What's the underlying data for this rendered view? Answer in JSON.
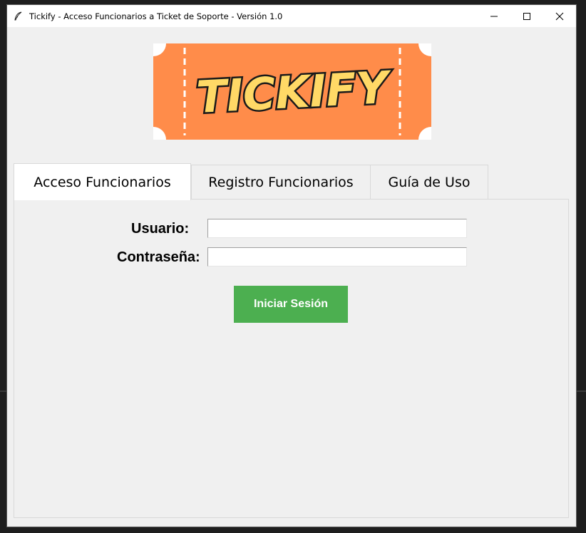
{
  "window": {
    "title": "Tickify - Acceso Funcionarios a Ticket de Soporte - Versión 1.0",
    "icon": "feather-icon",
    "controls": [
      "minimize-icon",
      "maximize-icon",
      "close-icon"
    ]
  },
  "logo": {
    "text": "TICKIFY",
    "colors": {
      "ticket": "#ff8c4a",
      "text_fill": "#ffd966",
      "text_outline": "#1a1a1a"
    }
  },
  "tabs": [
    {
      "label": "Acceso Funcionarios",
      "active": true
    },
    {
      "label": "Registro Funcionarios",
      "active": false
    },
    {
      "label": "Guía de Uso",
      "active": false
    }
  ],
  "login_form": {
    "username_label": "Usuario:",
    "username_value": "",
    "password_label": "Contraseña:",
    "password_value": "",
    "submit_label": "Iniciar Sesión",
    "submit_color": "#4caf50"
  }
}
